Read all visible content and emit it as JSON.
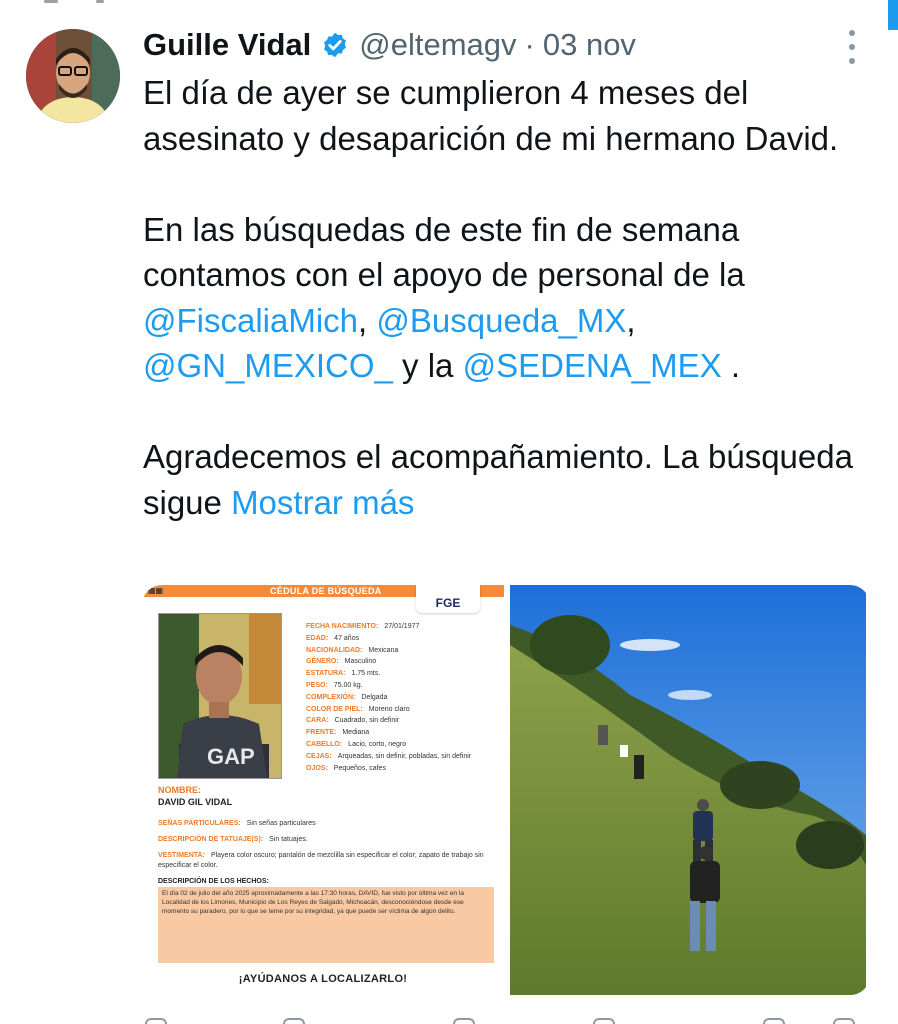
{
  "tweet": {
    "author": {
      "name": "Guille Vidal",
      "handle": "@eltemagv",
      "separator": "·",
      "date": "03 nov",
      "verified": true
    },
    "paragraphs": {
      "p1": "El día de ayer se cumplieron 4 meses del asesinato y desaparición de mi hermano David.",
      "p2_intro": "En las búsquedas de este fin de semana contamos con el apoyo de personal de la ",
      "mention1": "@FiscaliaMich",
      "sep1": ", ",
      "mention2": "@Busqueda_MX",
      "sep2": ", ",
      "mention3": "@GN_MEXICO_",
      "mid": " y la ",
      "mention4": "@SEDENA_MEX",
      "end": " .",
      "p3": "Agradecemos el acompañamiento. La búsqueda sigue ",
      "show_more": "Mostrar más"
    },
    "colors": {
      "link": "#1d9bf0",
      "text": "#0f1419",
      "muted": "#536471",
      "orange": "#f07a26"
    }
  },
  "cedula": {
    "title": "CÉDULA DE BÚSQUEDA",
    "agency": "FGE",
    "fields": [
      {
        "label": "FECHA NACIMIENTO:",
        "value": "27/01/1977"
      },
      {
        "label": "EDAD:",
        "value": "47 años"
      },
      {
        "label": "NACIONALIDAD:",
        "value": "Mexicana"
      },
      {
        "label": "GÉNERO:",
        "value": "Masculino"
      },
      {
        "label": "ESTATURA:",
        "value": "1.75 mts."
      },
      {
        "label": "PESO:",
        "value": "75.00 kg."
      },
      {
        "label": "COMPLEXIÓN:",
        "value": "Delgada"
      },
      {
        "label": "COLOR DE PIEL:",
        "value": "Moreno claro"
      },
      {
        "label": "CARA:",
        "value": "Cuadrado, sin definir"
      },
      {
        "label": "FRENTE:",
        "value": "Mediana"
      },
      {
        "label": "CABELLO:",
        "value": "Lacio, corto, negro"
      },
      {
        "label": "CEJAS:",
        "value": "Arqueadas, sin definir, pobladas, sin definir"
      },
      {
        "label": "OJOS:",
        "value": "Pequeños, cafes"
      }
    ],
    "nombre_label": "NOMBRE:",
    "nombre": "DAVID GIL VIDAL",
    "senas_label": "SEÑAS PARTICULARES:",
    "senas": "Sin señas particulares",
    "tatuajes_label": "DESCRIPCIÓN DE TATUAJE(S):",
    "tatuajes": "Sin tatuajes.",
    "vestimenta_label": "VESTIMENTA:",
    "vestimenta": "Playera color oscuro; pantalón de mezclilla sin especificar el color; zapato de trabajo sin especificar el color.",
    "hechos_label": "DESCRIPCIÓN DE LOS HECHOS:",
    "hechos": "El día 02 de julio del año 2025 aproximadamente a las 17:30 horas, DAVID, fue visto por última vez en la Localidad de los Limones, Municipio de Los Reyes de Salgado, Michoacán, desconociéndose desde ese momento su paradero, por lo que se teme por su integridad, ya que puede ser víctima de algún delito.",
    "cta": "¡AYÚDANOS A LOCALIZARLO!"
  }
}
